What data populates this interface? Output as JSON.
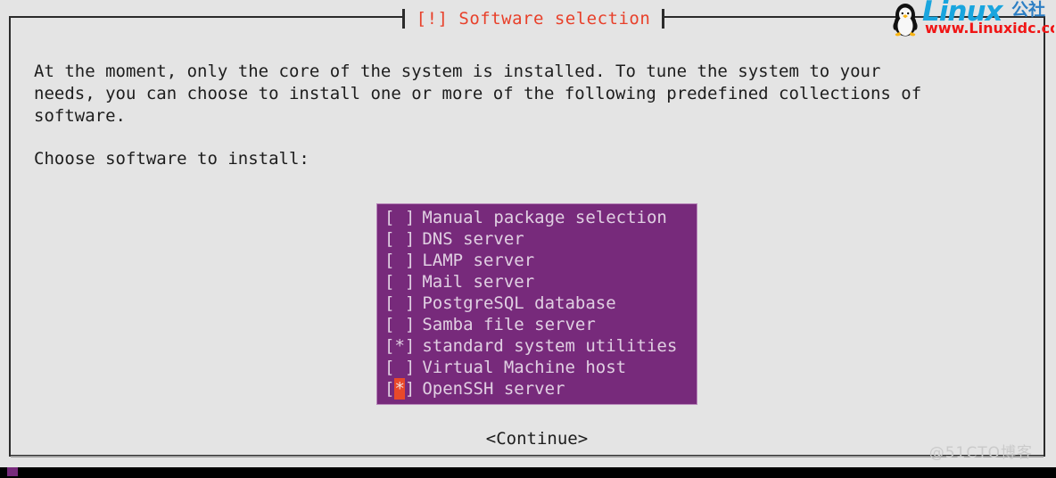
{
  "dialog": {
    "title": "[!] Software selection",
    "title_color": "#e8402a",
    "body_text": "At the moment, only the core of the system is installed. To tune the system to your\nneeds, you can choose to install one or more of the following predefined collections of\nsoftware.",
    "prompt": "Choose software to install:",
    "continue_label": "<Continue>"
  },
  "listbox": {
    "background_color": "#772a7b",
    "text_color": "#e0cfe2",
    "cursor_color": "#e8492a",
    "items": [
      {
        "mark": "[ ]",
        "checked": false,
        "label": "Manual package selection",
        "cursor": false
      },
      {
        "mark": "[ ]",
        "checked": false,
        "label": "DNS server",
        "cursor": false
      },
      {
        "mark": "[ ]",
        "checked": false,
        "label": "LAMP server",
        "cursor": false
      },
      {
        "mark": "[ ]",
        "checked": false,
        "label": "Mail server",
        "cursor": false
      },
      {
        "mark": "[ ]",
        "checked": false,
        "label": "PostgreSQL database",
        "cursor": false
      },
      {
        "mark": "[ ]",
        "checked": false,
        "label": "Samba file server",
        "cursor": false
      },
      {
        "mark": "[*]",
        "checked": true,
        "label": "standard system utilities",
        "cursor": false
      },
      {
        "mark": "[ ]",
        "checked": false,
        "label": "Virtual Machine host",
        "cursor": false
      },
      {
        "mark": "[*]",
        "checked": true,
        "label": "OpenSSH server",
        "cursor": true
      }
    ]
  },
  "watermarks": {
    "logo_text": "Linux",
    "logo_cn": "公社",
    "logo_url": "www.Linuxidc.com",
    "corner_text": "@51CTO博客"
  },
  "progress": {
    "bar_color": "#772a7b",
    "strip_color": "#000000"
  }
}
